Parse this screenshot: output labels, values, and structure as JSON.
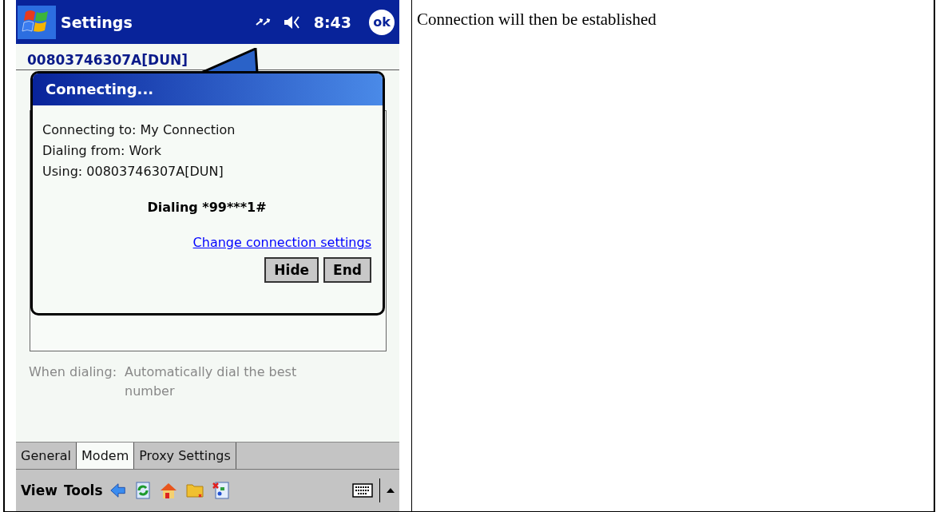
{
  "title_bar": {
    "title": "Settings",
    "time": "8:43",
    "ok": "ok"
  },
  "background_item": "00803746307A[DUN]",
  "dialing_option": {
    "label": "When dialing:",
    "value": "Automatically dial the best number"
  },
  "dialog": {
    "title": "Connecting...",
    "lines": [
      "Connecting to: My Connection",
      "Dialing from: Work",
      "Using: 00803746307A[DUN]"
    ],
    "status": "Dialing *99***1#",
    "link": "Change connection settings",
    "buttons": [
      "Hide",
      "End"
    ]
  },
  "tabs": [
    {
      "label": "General",
      "selected": false
    },
    {
      "label": "Modem",
      "selected": true
    },
    {
      "label": "Proxy Settings",
      "selected": false
    }
  ],
  "menu_bar": {
    "items": [
      "View",
      "Tools"
    ]
  },
  "caption": "Connection will then be established"
}
